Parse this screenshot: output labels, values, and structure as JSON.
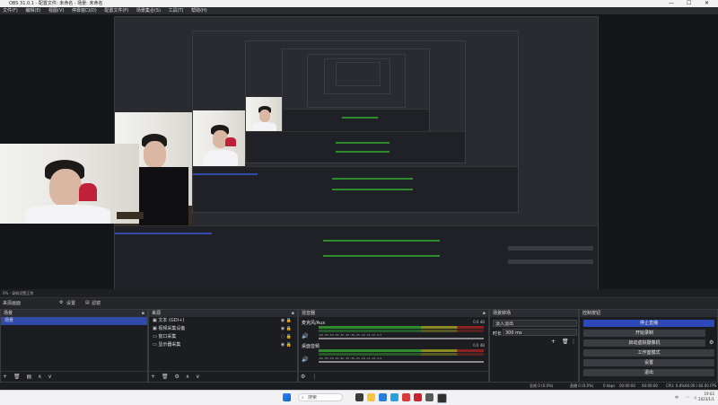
{
  "window": {
    "title": "OBS 31.0.1 - 配置文件: 未命名 - 场景: 未命名",
    "controls": [
      "—",
      "☐",
      "✕"
    ]
  },
  "menu": [
    "文件(F)",
    "编辑(E)",
    "视图(V)",
    "停靠窗口(D)",
    "配置文件(P)",
    "场景集合(S)",
    "工具(T)",
    "帮助(H)"
  ],
  "preview": {
    "strip_text": "0% · 录制设置正常",
    "scene_row": {
      "label": "来源画面",
      "settings": "设置",
      "filters": "滤镜"
    }
  },
  "scenes": {
    "title": "场景",
    "items": [
      "场景"
    ]
  },
  "sources": {
    "title": "来源",
    "items": [
      {
        "icon": "camera-icon",
        "label": "文本 (GDI+)"
      },
      {
        "icon": "camera-icon",
        "label": "视频采集设备"
      },
      {
        "icon": "display-icon",
        "label": "窗口采集"
      },
      {
        "icon": "display-icon",
        "label": "显示器采集"
      }
    ]
  },
  "mixer": {
    "title": "混音器",
    "channels": [
      {
        "name": "麦克风/Aux",
        "db": "0.0 dB",
        "level": 0.62
      },
      {
        "name": "桌面音频",
        "db": "0.0 dB",
        "level": 0.58
      }
    ],
    "scale": "-60 -55 -50 -45 -40 -35 -30 -25 -20 -15 -10 -5 0"
  },
  "transitions": {
    "title": "场景转场",
    "type": "淡入淡出",
    "duration_label": "时长",
    "duration": "300 ms"
  },
  "controls": {
    "title": "控制按钮",
    "buttons": [
      "停止直播",
      "开始录制",
      "启动虚拟摄像机",
      "工作室模式",
      "设置",
      "退出"
    ]
  },
  "status": {
    "dropped": "丢帧 0 (0.0%)",
    "stream": "直播 0 (0.0%)",
    "bitrate": "0 kbps",
    "stream_time": "00:00:00",
    "rec_time": "00:00:00",
    "cpu": "CPU: 0.8%",
    "fps": "60.00 / 60.00 FPS"
  },
  "taskbar": {
    "search_placeholder": "搜索",
    "time": "19:02",
    "date": "2023/1/1",
    "lang": "中"
  },
  "colors": {
    "accent": "#2d48b8",
    "selected": "#2f4aa8",
    "meter_green": "#2e8b2e",
    "meter_yellow": "#8a8a24",
    "meter_red": "#8a2222"
  }
}
